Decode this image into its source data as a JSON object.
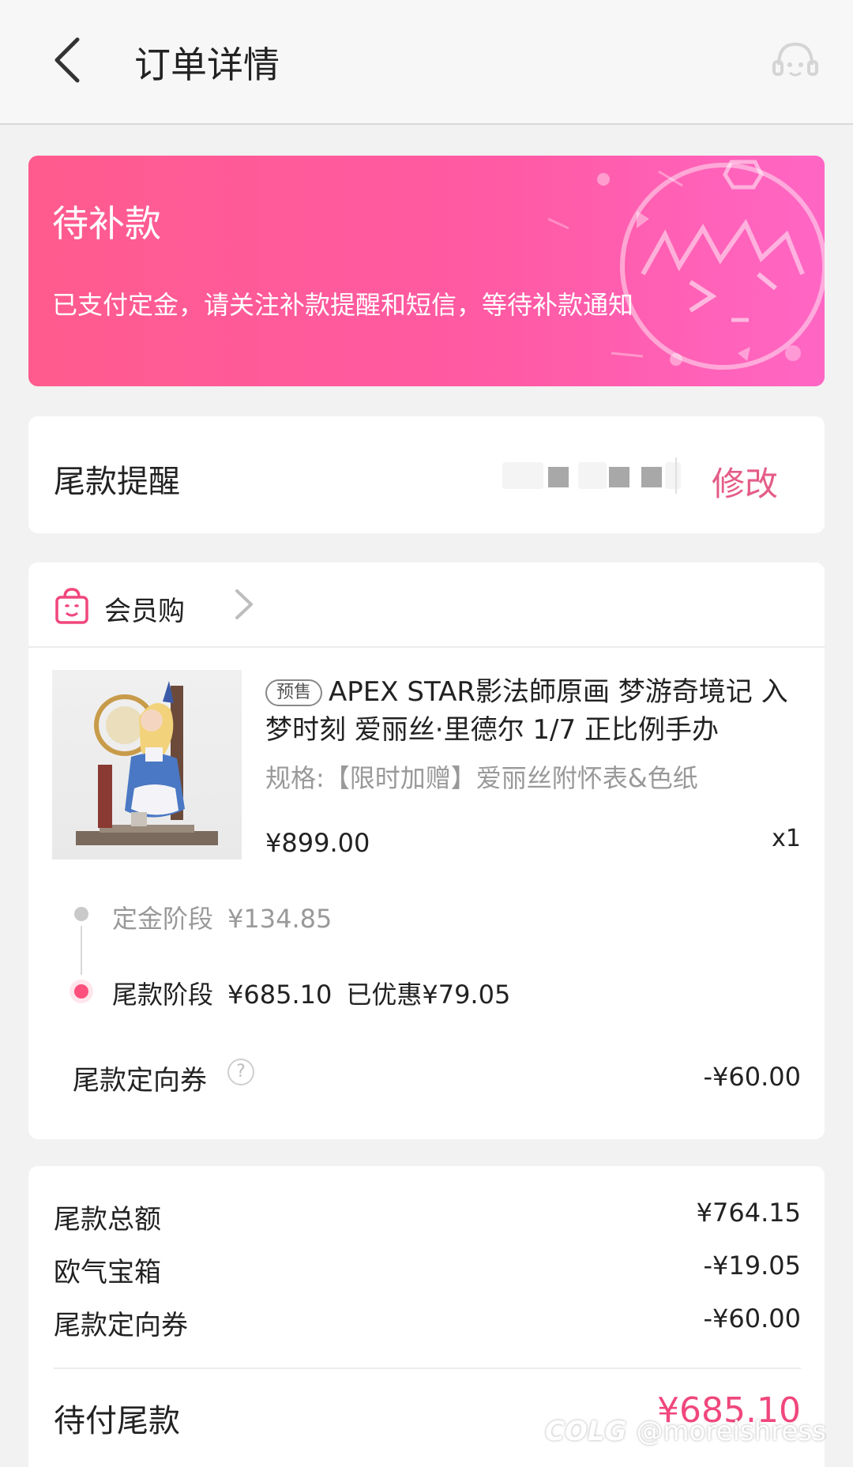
{
  "nav": {
    "title": "订单详情"
  },
  "status": {
    "title": "待补款",
    "description": "已支付定金，请关注补款提醒和短信，等待补款通知"
  },
  "reminder": {
    "label": "尾款提醒",
    "action": "修改"
  },
  "shop": {
    "name": "会员购"
  },
  "product": {
    "tag": "预售",
    "name": "APEX STAR影法師原画 梦游奇境记 入梦时刻 爱丽丝·里德尔 1/7 正比例手办",
    "spec": "规格:【限时加赠】爱丽丝附怀表&色纸",
    "price": "¥899.00",
    "qty": "x1"
  },
  "stages": {
    "deposit_label": "定金阶段",
    "deposit_amount": "¥134.85",
    "final_label": "尾款阶段",
    "final_amount": "¥685.10",
    "final_discount": "已优惠¥79.05"
  },
  "coupon": {
    "label": "尾款定向券",
    "help": "?",
    "value": "-¥60.00"
  },
  "summary": {
    "rows": [
      {
        "label": "尾款总额",
        "value": "¥764.15"
      },
      {
        "label": "欧气宝箱",
        "value": "-¥19.05"
      },
      {
        "label": "尾款定向券",
        "value": "-¥60.00"
      }
    ],
    "due_label": "待付尾款",
    "due_value": "¥685.10"
  },
  "watermark": {
    "logo": "COLG",
    "handle": "@moreishress"
  },
  "colors": {
    "accent": "#f0477d",
    "banner_start": "#ff5b8e",
    "banner_end": "#ff66c4",
    "edit_link": "#e45c87"
  }
}
